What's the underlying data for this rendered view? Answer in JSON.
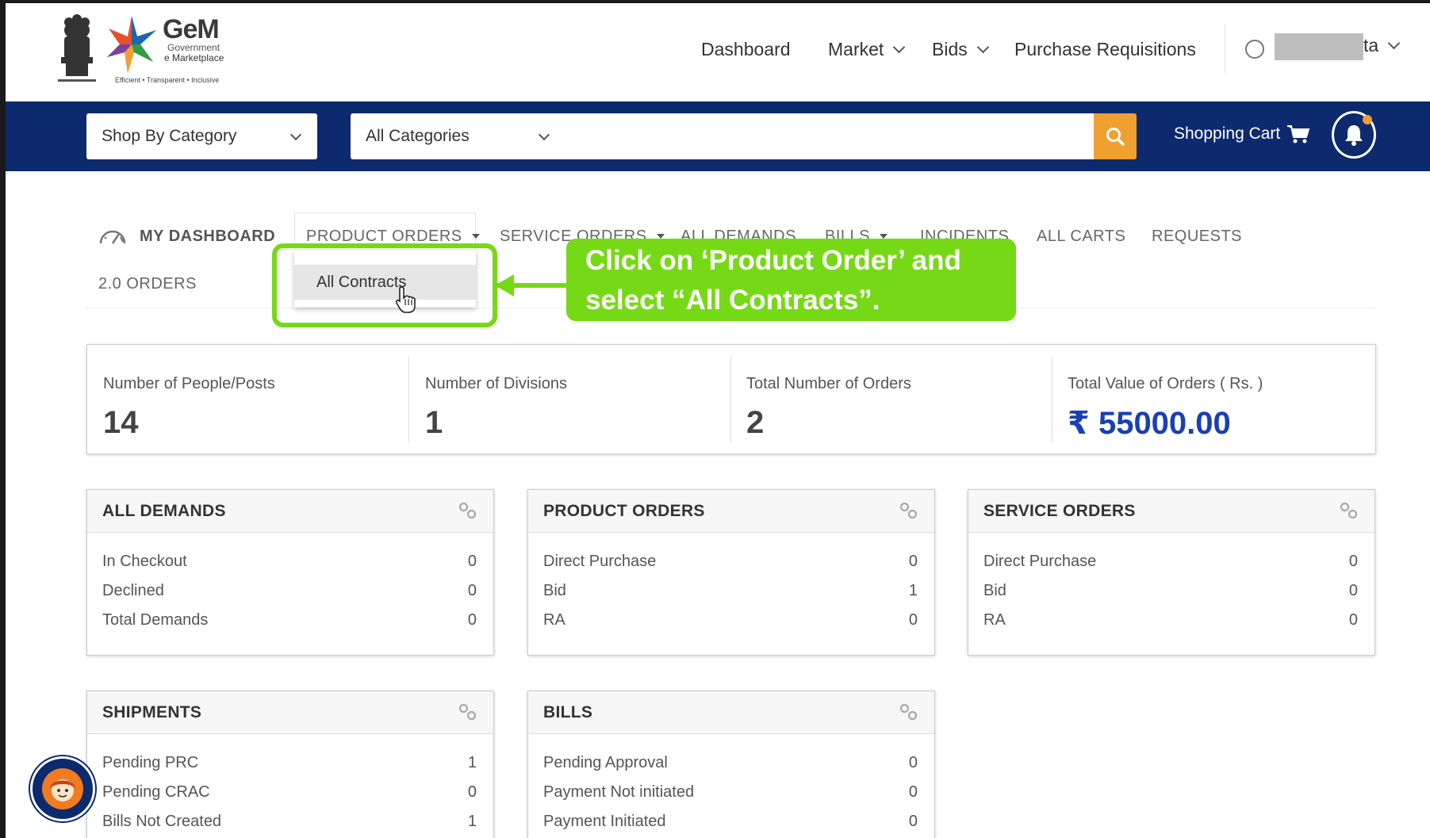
{
  "header": {
    "brand_title": "GeM",
    "brand_sub1": "Government",
    "brand_sub2": "e Marketplace",
    "brand_tagline": "Efficient • Transparent • Inclusive",
    "nav": {
      "dashboard": "Dashboard",
      "market": "Market",
      "bids": "Bids",
      "purchase_requisitions": "Purchase Requisitions"
    },
    "user_name_suffix": "ta"
  },
  "searchbar": {
    "shop_by_category": "Shop By Category",
    "all_categories": "All Categories",
    "search_placeholder": "",
    "shopping_cart": "Shopping Cart"
  },
  "subnav": {
    "my_dashboard": "MY DASHBOARD",
    "product_orders": "PRODUCT ORDERS",
    "service_orders": "SERVICE ORDERS",
    "all_demands": "ALL DEMANDS",
    "bills": "BILLS",
    "incidents": "INCIDENTS",
    "all_carts": "ALL CARTS",
    "requests": "REQUESTS",
    "orders_2": "2.0 ORDERS",
    "dropdown_all_contracts": "All Contracts"
  },
  "callout": {
    "line1": "Click on ‘Product Order’ and",
    "line2": "select “All Contracts”."
  },
  "stats": [
    {
      "label": "Number of People/Posts",
      "value": "14"
    },
    {
      "label": "Number of Divisions",
      "value": "1"
    },
    {
      "label": "Total Number of Orders",
      "value": "2"
    },
    {
      "label": "Total Value of Orders ( Rs. )",
      "value": "₹ 55000.00"
    }
  ],
  "cards": {
    "all_demands": {
      "title": "ALL DEMANDS",
      "rows": [
        {
          "label": "In Checkout",
          "value": "0"
        },
        {
          "label": "Declined",
          "value": "0"
        },
        {
          "label": "Total Demands",
          "value": "0"
        }
      ]
    },
    "product_orders": {
      "title": "PRODUCT ORDERS",
      "rows": [
        {
          "label": "Direct Purchase",
          "value": "0"
        },
        {
          "label": "Bid",
          "value": "1"
        },
        {
          "label": "RA",
          "value": "0"
        }
      ]
    },
    "service_orders": {
      "title": "SERVICE ORDERS",
      "rows": [
        {
          "label": "Direct Purchase",
          "value": "0"
        },
        {
          "label": "Bid",
          "value": "0"
        },
        {
          "label": "RA",
          "value": "0"
        }
      ]
    },
    "shipments": {
      "title": "SHIPMENTS",
      "rows": [
        {
          "label": "Pending PRC",
          "value": "1"
        },
        {
          "label": "Pending CRAC",
          "value": "0"
        },
        {
          "label": "Bills Not Created",
          "value": "1"
        }
      ]
    },
    "bills": {
      "title": "BILLS",
      "rows": [
        {
          "label": "Pending Approval",
          "value": "0"
        },
        {
          "label": "Payment Not initiated",
          "value": "0"
        },
        {
          "label": "Payment Initiated",
          "value": "0"
        }
      ]
    }
  },
  "colors": {
    "brand_blue": "#0d2a6e",
    "accent_orange": "#f0a030",
    "callout_green": "#76d916",
    "money_blue": "#1a3fb5"
  }
}
